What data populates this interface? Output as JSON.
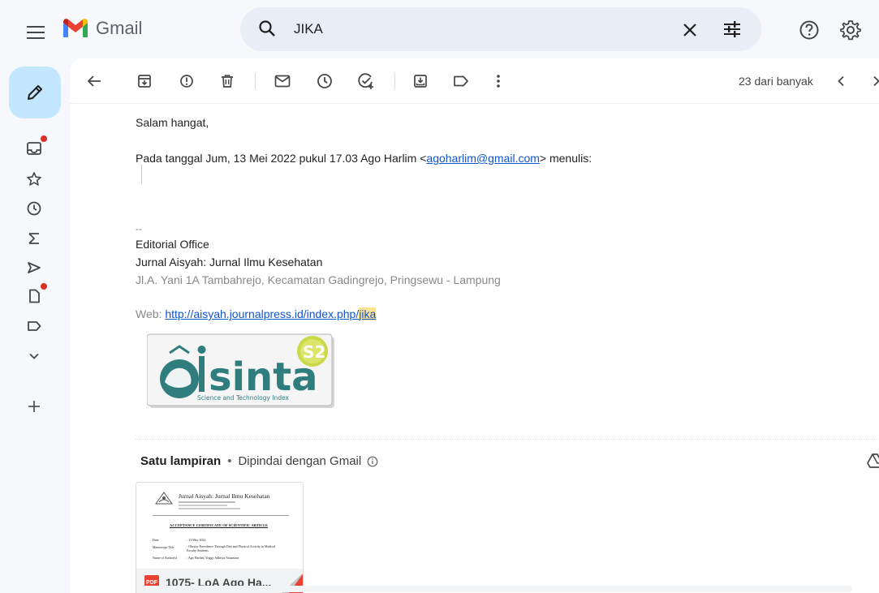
{
  "app": {
    "name": "Gmail"
  },
  "search": {
    "query": "JIKA"
  },
  "toolbar": {
    "pager": "23 dari banyak"
  },
  "email": {
    "greeting": "Salam hangat,",
    "quote_prefix": "Pada tanggal Jum, 13 Mei 2022 pukul 17.03 Ago Harlim <",
    "quote_email": "agoharlim@gmail.com",
    "quote_suffix": "> menulis:",
    "sig_dash": "--",
    "sig_office": "Editorial Office",
    "sig_journal": "Jurnal Aisyah: Jurnal Ilmu Kesehatan",
    "sig_address": "Jl.A. Yani 1A Tambahrejo, Kecamatan Gadingrejo, Pringsewu - Lampung",
    "web_label": "Web: ",
    "web_link": "http://aisyah.journalpress.id/index.php/",
    "web_highlight": "jika"
  },
  "logo": {
    "text": "sinta",
    "badge": "S2",
    "tagline": "Science and Technology Index"
  },
  "attachments": {
    "title": "Satu lampiran",
    "scanned": "Dipindai dengan Gmail",
    "file_name": "1075- LoA Ago Ha...",
    "file_type": "PDF",
    "preview": {
      "journal": "Jurnal Aisyah: Jurnal Ilmu Kesehatan",
      "heading": "ACCEPTANCE CERTIFICATE OF SCIENTIFIC ARTICLE",
      "date_label": "Date",
      "date_value": ": 13 May 2022",
      "title_label": "Manuscript Title",
      "title_value": ": Obesity Prevalence Through Diet and Physical Activity in Medical Faculty Students",
      "author_label": "Name of Author(s)",
      "author_value": ": Ago Harlim, Yoggy Adhitya Nusantara"
    }
  },
  "colors": {
    "compose": "#c2e7ff",
    "search_bg": "#e9eef6",
    "link": "#1155cc",
    "highlight": "#fde293",
    "badge_dot": "#d93025"
  }
}
